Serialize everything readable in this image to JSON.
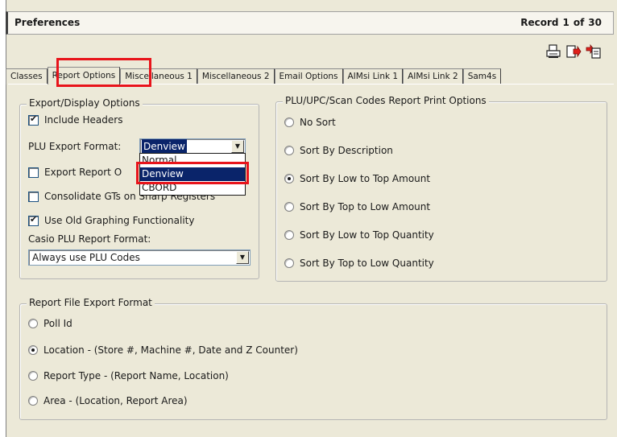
{
  "window": {
    "title": "Preferences",
    "record_label": "Record",
    "record_current": "1",
    "record_of": "of",
    "record_total": "30"
  },
  "toolbar": {
    "icons": [
      "print-icon",
      "export-icon",
      "export-options-icon"
    ]
  },
  "tabs": [
    {
      "label": "Classes",
      "active": false
    },
    {
      "label": "Report Options",
      "active": true
    },
    {
      "label": "Miscellaneous 1",
      "active": false
    },
    {
      "label": "Miscellaneous 2",
      "active": false
    },
    {
      "label": "Email Options",
      "active": false
    },
    {
      "label": "AIMsi Link 1",
      "active": false
    },
    {
      "label": "AIMsi Link 2",
      "active": false
    },
    {
      "label": "Sam4s",
      "active": false
    }
  ],
  "export_display": {
    "legend": "Export/Display Options",
    "include_headers": {
      "label": "Include Headers",
      "checked": true
    },
    "plu_export_format_label": "PLU Export Format:",
    "plu_export_format_value": "Denview",
    "plu_export_format_options": [
      "Normal",
      "Denview",
      "CBORD"
    ],
    "export_report_label": "Export Report O",
    "export_report_checked": false,
    "consolidate_label": "Consolidate GTs on Sharp Registers",
    "consolidate_checked": false,
    "old_graphing": {
      "label": "Use Old Graphing Functionality",
      "checked": true
    },
    "casio_label": "Casio PLU Report Format:",
    "casio_value": "Always use PLU Codes"
  },
  "plu_print": {
    "legend": "PLU/UPC/Scan Codes Report Print Options",
    "options": [
      {
        "label": "No Sort",
        "checked": false
      },
      {
        "label": "Sort By Description",
        "checked": false
      },
      {
        "label": "Sort By Low to Top Amount",
        "checked": true
      },
      {
        "label": "Sort By Top to Low Amount",
        "checked": false
      },
      {
        "label": "Sort By Low to Top Quantity",
        "checked": false
      },
      {
        "label": "Sort By Top to Low Quantity",
        "checked": false
      }
    ]
  },
  "file_export": {
    "legend": "Report File Export Format",
    "options": [
      {
        "label": "Poll Id",
        "checked": false
      },
      {
        "label": "Location - (Store #, Machine #, Date and Z Counter)",
        "checked": true
      },
      {
        "label": "Report Type - (Report Name, Location)",
        "checked": false
      },
      {
        "label": "Area - (Location, Report Area)",
        "checked": false
      }
    ]
  },
  "colors": {
    "highlight": "#e8141b",
    "selection": "#0a246a",
    "panel": "#ece9d8"
  }
}
